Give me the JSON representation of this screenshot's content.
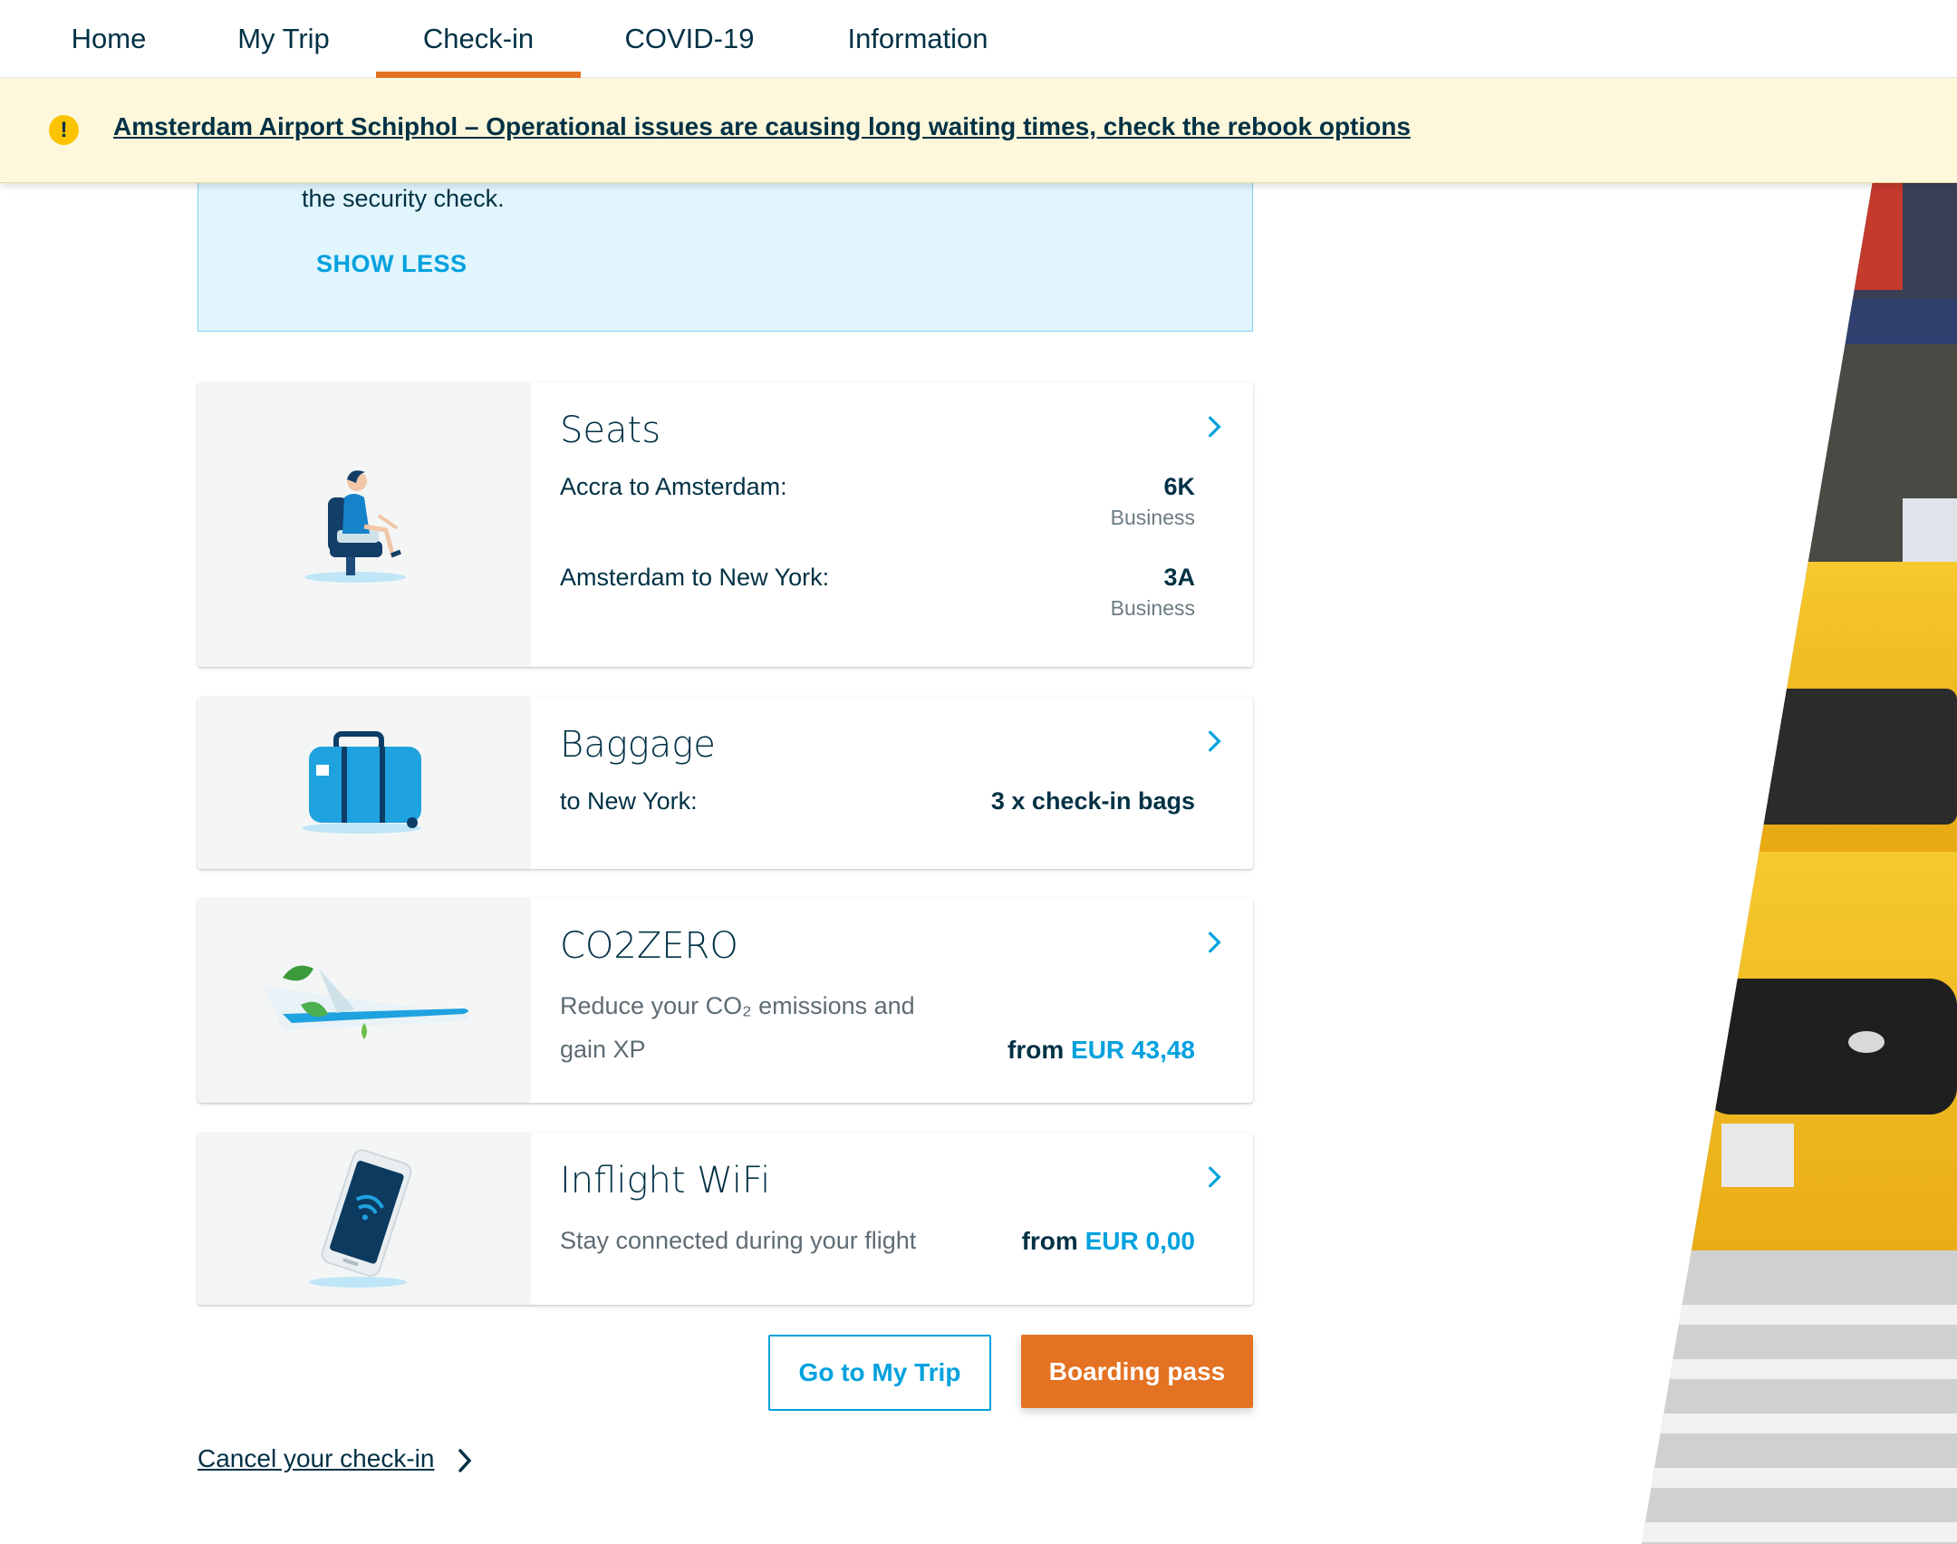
{
  "nav": {
    "tabs": [
      {
        "label": "Home"
      },
      {
        "label": "My Trip"
      },
      {
        "label": "Check-in",
        "active": true
      },
      {
        "label": "COVID-19"
      },
      {
        "label": "Information"
      }
    ]
  },
  "alert": {
    "icon": "warning-icon",
    "text": "Amsterdam Airport Schiphol – Operational issues are causing long waiting times, check the rebook options"
  },
  "info_box": {
    "text": "the security check.",
    "toggle_label": "SHOW LESS"
  },
  "cards": {
    "seats": {
      "title": "Seats",
      "illustration": "passenger-seat-illustration",
      "rows": [
        {
          "label": "Accra to Amsterdam:",
          "value": "6K",
          "class": "Business"
        },
        {
          "label": "Amsterdam to New York:",
          "value": "3A",
          "class": "Business"
        }
      ]
    },
    "baggage": {
      "title": "Baggage",
      "illustration": "suitcase-illustration",
      "label": "to New York:",
      "value": "3 x check-in bags"
    },
    "co2zero": {
      "title": "CO2ZERO",
      "illustration": "plane-with-leaves-illustration",
      "description_line1": "Reduce your CO₂ emissions and",
      "description_line2": "gain XP",
      "price_prefix": "from",
      "price": "EUR 43,48"
    },
    "wifi": {
      "title": "Inflight WiFi",
      "illustration": "smartphone-wifi-illustration",
      "description": "Stay connected during your flight",
      "price_prefix": "from",
      "price": "EUR 0,00"
    }
  },
  "actions": {
    "go_to_my_trip": "Go to My Trip",
    "boarding_pass": "Boarding pass",
    "cancel_checkin": "Cancel your check-in"
  },
  "colors": {
    "primary_blue": "#00a1de",
    "dark_navy": "#003145",
    "accent_orange": "#e37222",
    "alert_yellow": "#fdf7db",
    "info_blue": "#e1f5fd"
  }
}
